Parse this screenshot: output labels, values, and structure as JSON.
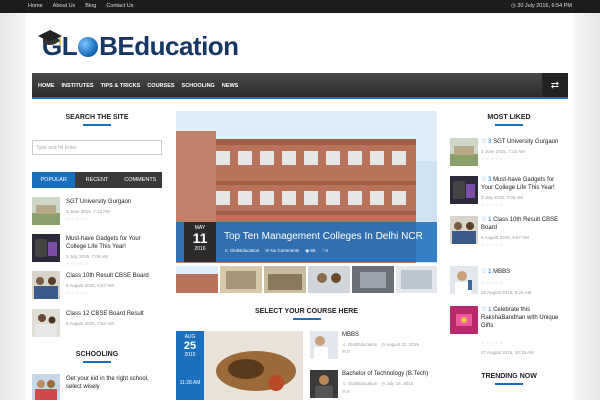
{
  "topbar": {
    "links": [
      "Home",
      "About Us",
      "Blog",
      "Contact Us"
    ],
    "date": "30 July 2016, 6:54 PM"
  },
  "logo": {
    "part1": "GL",
    "part2": "B",
    "part3": "Education"
  },
  "nav": {
    "items": [
      "HOME",
      "INSTITUTES",
      "TIPS & TRICKS",
      "COURSES",
      "SCHOOLING",
      "NEWS"
    ]
  },
  "left": {
    "search_title": "SEARCH THE SITE",
    "search_placeholder": "Type and hit Enter",
    "tabs": [
      "POPULAR",
      "RECENT",
      "COMMENTS"
    ],
    "posts": [
      {
        "title1": "SGT University Gurgaon",
        "title2": "",
        "date": "3 June 2015, 7:12 AM"
      },
      {
        "title1": "Must-have Gadgets for Your",
        "title2": "College Life This Year!",
        "date": "3 July 2015, 7:06 AM"
      },
      {
        "title1": "Class 10th Result CBSE Board",
        "title2": "",
        "date": "5 August 2015, 6:57 AM"
      },
      {
        "title1": "Class 12 CBSE Board Result",
        "title2": "",
        "date": "5 August 2015, 7:52 AM"
      }
    ],
    "schooling_title": "SCHOOLING",
    "schooling_post": {
      "title1": "Get your kid in the right school,",
      "title2": "select wisely"
    }
  },
  "slider": {
    "month": "MAY",
    "day": "11",
    "year": "2016",
    "title": "Top Ten Management Colleges In Delhi NCR",
    "author": "GlobEducation",
    "comments": "No Comments",
    "views": "95",
    "likes": "0"
  },
  "courses": {
    "title": "SELECT YOUR COURSE HERE",
    "date_month": "AUG",
    "date_day": "25",
    "date_year": "2015",
    "date_time": "11:28 AM",
    "items": [
      {
        "title": "MBBS",
        "author": "GlobEducation",
        "date": "August 22, 2015",
        "count": "0"
      },
      {
        "title": "Bachelor of Technology (B.Tech)",
        "author": "GlobEducation",
        "date": "July 16, 2015",
        "count": "0"
      }
    ]
  },
  "right": {
    "most_liked_title": "MOST LIKED",
    "posts": [
      {
        "num": "3",
        "title1": "SGT University Gurgaon",
        "title2": "",
        "title3": "",
        "date": "3 June 2015, 7:12 AM"
      },
      {
        "num": "3",
        "title1": "Must-have Gadgets for",
        "title2": "Your College Life This Year!",
        "title3": "",
        "date": "3 July 2015, 7:06 AM"
      },
      {
        "num": "1",
        "title1": "Class 10th Result CBSE",
        "title2": "Board",
        "title3": "",
        "date": "5 August 2015, 6:57 AM"
      },
      {
        "num": "1",
        "title1": "MBBS",
        "title2": "",
        "title3": "",
        "date": "22 August 2015, 8:24 AM"
      },
      {
        "num": "1",
        "title1": "Celebrate this",
        "title2": "RakshaBandhan with Unique",
        "title3": "Gifts",
        "date": "27 August 2015, 10:18 AM"
      }
    ],
    "trending_title": "TRENDING NOW"
  },
  "colors": {
    "accent": "#1a6fbf",
    "dark": "#2b2b2b"
  }
}
